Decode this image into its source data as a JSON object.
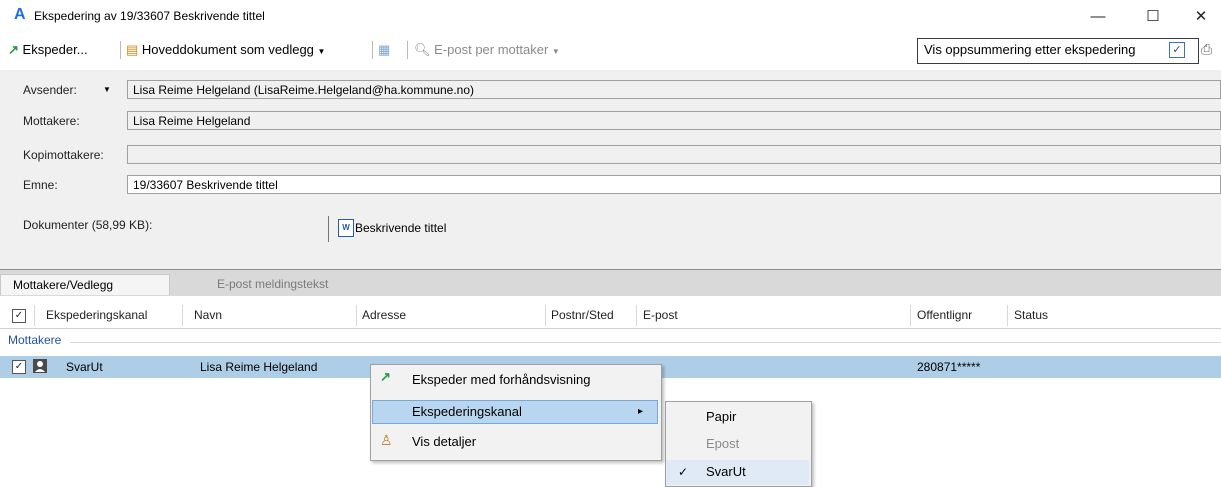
{
  "window": {
    "title": "Ekspedering av 19/33607 Beskrivende tittel",
    "app_icon": "A",
    "minimize": "—",
    "maximize": "☐",
    "close": "✕"
  },
  "toolbar": {
    "ekspeder": "Ekspeder...",
    "main_doc": "Hoveddokument som vedlegg",
    "email_per": "E-post per mottaker",
    "summary_label": "Vis oppsummering etter ekspedering",
    "summary_checked": "✓"
  },
  "form": {
    "sender_label": "Avsender:",
    "sender_value": "Lisa Reime Helgeland (LisaReime.Helgeland@ha.kommune.no)",
    "recipients_label": "Mottakere:",
    "recipients_value": "Lisa Reime Helgeland",
    "cc_label": "Kopimottakere:",
    "cc_value": "",
    "subject_label": "Emne:",
    "subject_value": "19/33607 Beskrivende tittel",
    "documents_label": "Dokumenter (58,99 KB):",
    "document_name": "Beskrivende tittel",
    "doc_icon": "W"
  },
  "tabs": [
    {
      "label": "Mottakere/Vedlegg"
    },
    {
      "label": "E-post meldingstekst"
    }
  ],
  "grid": {
    "columns": [
      "Ekspederingskanal",
      "Navn",
      "Adresse",
      "Postnr/Sted",
      "E-post",
      "Offentlignr",
      "Status"
    ],
    "group": "Mottakere",
    "row": {
      "channel": "SvarUt",
      "name": "Lisa Reime Helgeland",
      "address": "",
      "postnr": "",
      "email": "",
      "offentlignr": "280871*****",
      "status": ""
    }
  },
  "context_menu": {
    "items": [
      "Ekspeder med forhåndsvisning",
      "Ekspederingskanal",
      "Vis detaljer"
    ],
    "arrow": "▸"
  },
  "submenu": {
    "items": [
      "Papir",
      "Epost",
      "SvarUt"
    ],
    "checkmark": "✓"
  }
}
